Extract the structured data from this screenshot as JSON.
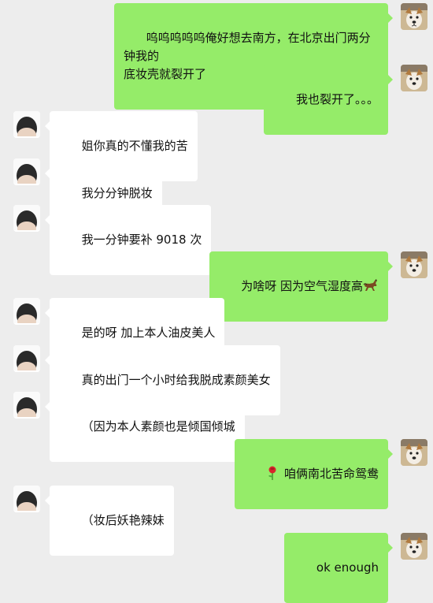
{
  "messages": [
    {
      "sender": "me",
      "text": "呜呜呜呜呜俺好想去南方，在北京出门两分钟我的\n底妆壳就裂开了"
    },
    {
      "sender": "me",
      "text": "我也裂开了。。。"
    },
    {
      "sender": "other",
      "text": "姐你真的不懂我的苦"
    },
    {
      "sender": "other",
      "text": "我分分钟脱妆"
    },
    {
      "sender": "other",
      "text": "我一分钟要补 9018 次"
    },
    {
      "sender": "me",
      "text": "为啥呀 因为空气湿度高",
      "trailing_emoji": "running-horse-icon"
    },
    {
      "sender": "other",
      "text": "是的呀 加上本人油皮美人"
    },
    {
      "sender": "other",
      "text": "真的出门一个小时给我脱成素颜美女"
    },
    {
      "sender": "other",
      "text": "（因为本人素颜也是倾国倾城"
    },
    {
      "sender": "me",
      "text": "咱俩南北苦命鸳鸯",
      "leading_emoji": "rose-icon"
    },
    {
      "sender": "other",
      "text": "（妆后妖艳辣妹"
    },
    {
      "sender": "me",
      "text": "ok enough"
    }
  ],
  "colors": {
    "background": "#ededed",
    "my_bubble": "#95ec69",
    "other_bubble": "#ffffff",
    "text": "#111111"
  }
}
